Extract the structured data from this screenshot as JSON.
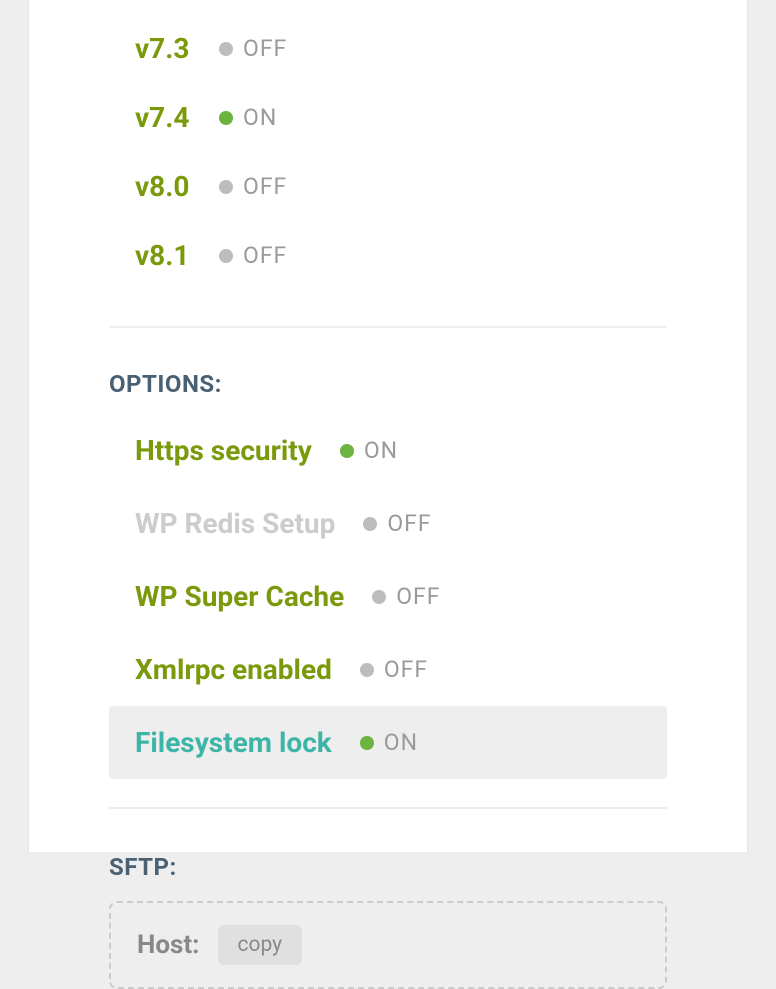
{
  "versions": [
    {
      "label": "v7.3",
      "status": "OFF",
      "on": false
    },
    {
      "label": "v7.4",
      "status": "ON",
      "on": true
    },
    {
      "label": "v8.0",
      "status": "OFF",
      "on": false
    },
    {
      "label": "v8.1",
      "status": "OFF",
      "on": false
    }
  ],
  "options_header": "OPTIONS:",
  "options": [
    {
      "label": "Https security",
      "status": "ON",
      "on": true,
      "disabled": false,
      "highlighted": false
    },
    {
      "label": "WP Redis Setup",
      "status": "OFF",
      "on": false,
      "disabled": true,
      "highlighted": false
    },
    {
      "label": "WP Super Cache",
      "status": "OFF",
      "on": false,
      "disabled": false,
      "highlighted": false
    },
    {
      "label": "Xmlrpc enabled",
      "status": "OFF",
      "on": false,
      "disabled": false,
      "highlighted": false
    },
    {
      "label": "Filesystem lock",
      "status": "ON",
      "on": true,
      "disabled": false,
      "highlighted": true
    }
  ],
  "sftp_header": "SFTP:",
  "sftp": {
    "host_label": "Host:",
    "copy_label": "copy"
  }
}
